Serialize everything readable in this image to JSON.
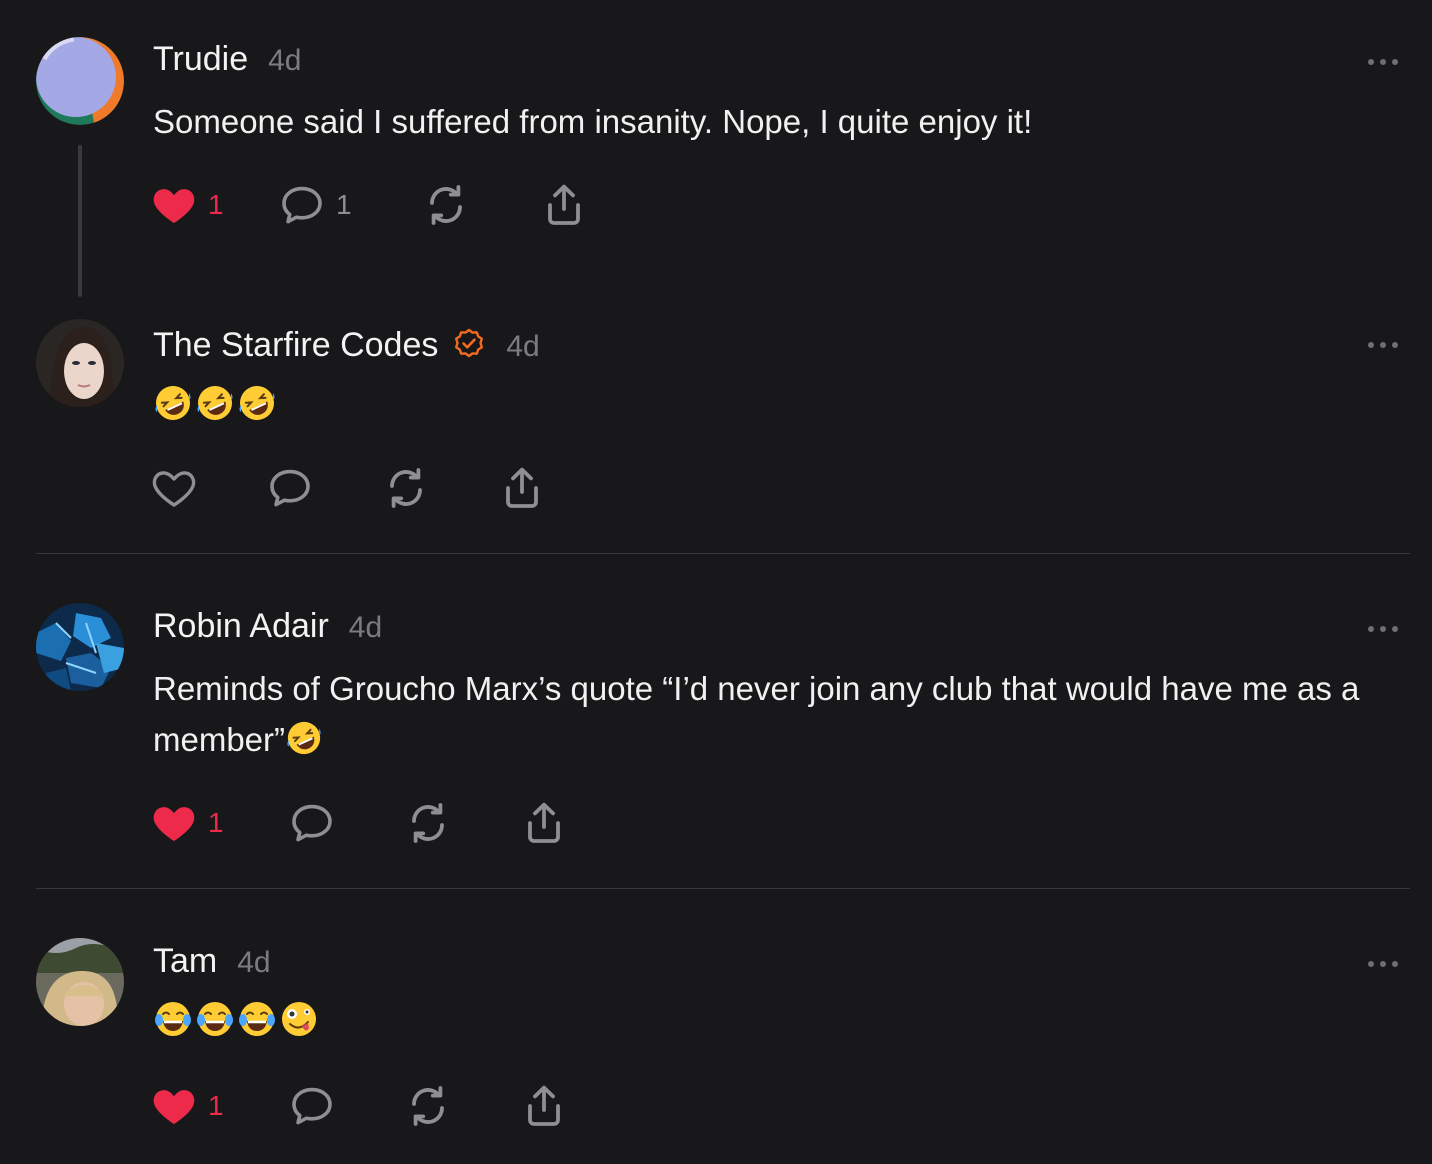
{
  "comments": [
    {
      "author": "Trudie",
      "time": "4d",
      "text": "Someone said I suffered from insanity. Nope, I quite enjoy it!",
      "likes": "1",
      "replies": "1",
      "liked": true
    },
    {
      "author": "The Starfire Codes",
      "time": "4d",
      "verified": true,
      "emoji": [
        "rolling-laughing",
        "rolling-laughing",
        "rolling-laughing"
      ],
      "liked": false
    },
    {
      "author": "Robin Adair",
      "time": "4d",
      "text": "Reminds of  Groucho Marx’s quote “I’d never join any club that would have me as a member”",
      "likes": "1",
      "liked": true
    },
    {
      "author": "Tam",
      "time": "4d",
      "emoji": [
        "tears-of-joy",
        "tears-of-joy",
        "tears-of-joy",
        "zany-face"
      ],
      "likes": "1",
      "liked": true
    }
  ],
  "colors": {
    "background": "#18181a",
    "like": "#ee2a4a",
    "muted": "#7c7c80",
    "verified": "#f26b21"
  }
}
